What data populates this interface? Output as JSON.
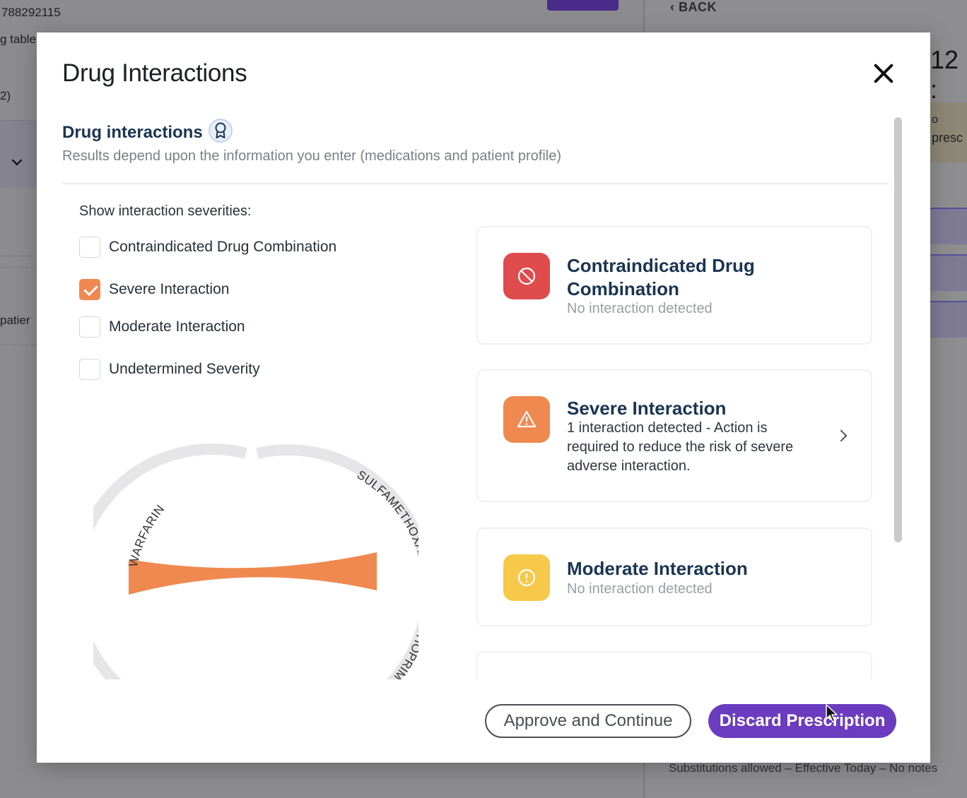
{
  "background": {
    "id_number": "788292115",
    "fragment_table": "g table",
    "fragment_paren": "2)",
    "fragment_patient": "patier",
    "back_label": "BACK",
    "big_fragment": "12 :",
    "side_fragment_a": "o",
    "side_fragment_b": "presc",
    "footer_text": "Substitutions allowed – Effective Today – No notes",
    "accent_purple": "#4a2a8a"
  },
  "modal": {
    "title": "Drug Interactions",
    "close_icon": "close-icon",
    "section_title": "Drug interactions",
    "section_icon": "ribbon-award-icon",
    "section_subtitle": "Results depend upon the information you enter (medications and patient profile)",
    "severity_label": "Show interaction severities:",
    "filters": [
      {
        "label": "Contraindicated Drug Combination",
        "checked": false
      },
      {
        "label": "Severe Interaction",
        "checked": true
      },
      {
        "label": "Moderate Interaction",
        "checked": false
      },
      {
        "label": "Undetermined Severity",
        "checked": false
      }
    ],
    "chord": {
      "drug_a": "WARFARIN",
      "drug_b": "SULFAMETHOXAZOLE-TRIMETHOPRIM",
      "link_color": "#f0894f",
      "ring_color": "#e6e6e8"
    },
    "cards": [
      {
        "title_line1": "Contraindicated Drug",
        "title_line2": "Combination",
        "desc": "No interaction detected",
        "icon": "prohibited-icon",
        "color": "#e04b4b"
      },
      {
        "title_line1": "Severe Interaction",
        "desc_line1": "1 interaction detected - Action is",
        "desc_line2": "required to reduce the risk of severe",
        "desc_line3": "adverse interaction.",
        "icon": "warning-triangle-icon",
        "color": "#f0894f"
      },
      {
        "title_line1": "Moderate Interaction",
        "desc": "No interaction detected",
        "icon": "info-circle-icon",
        "color": "#f6c94a"
      }
    ],
    "buttons": {
      "approve": "Approve and Continue",
      "discard": "Discard Prescription",
      "discard_color": "#6b3cc0"
    }
  }
}
